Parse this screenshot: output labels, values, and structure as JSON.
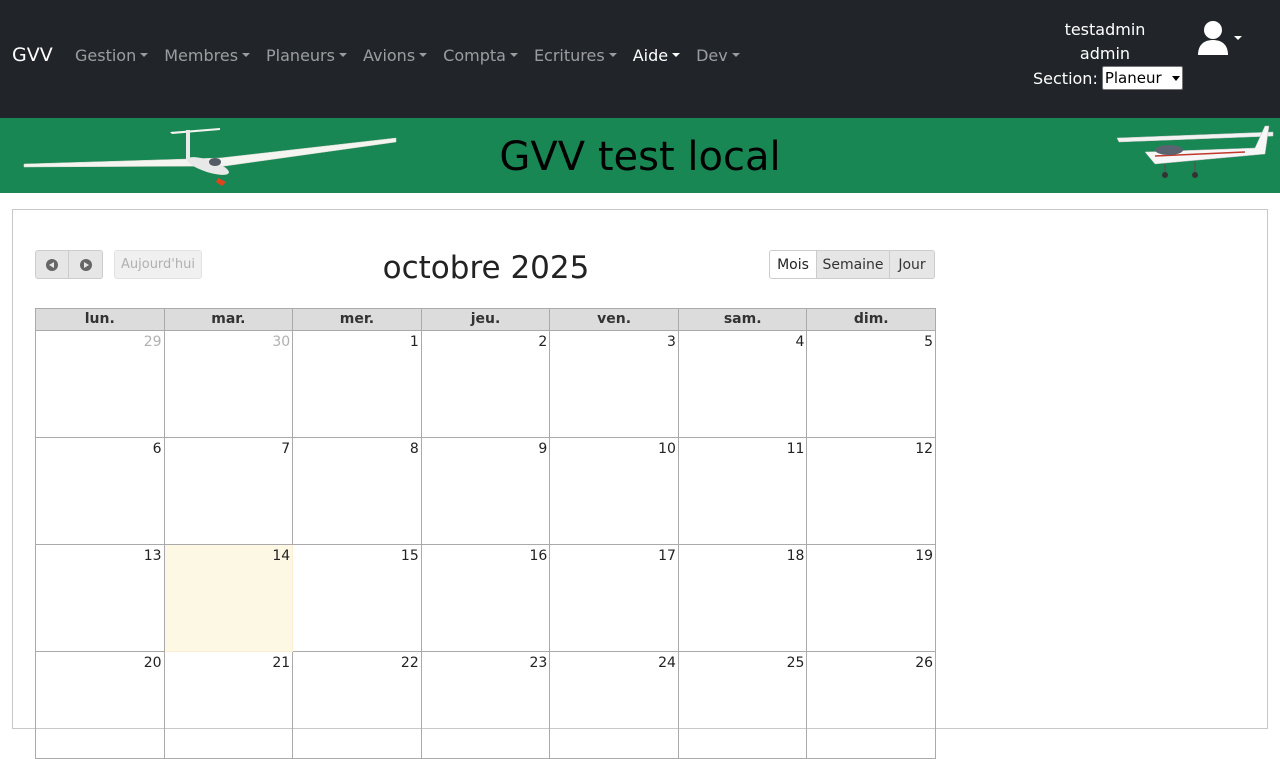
{
  "navbar": {
    "brand": "GVV",
    "menu": [
      {
        "label": "Gestion"
      },
      {
        "label": "Membres"
      },
      {
        "label": "Planeurs"
      },
      {
        "label": "Avions"
      },
      {
        "label": "Compta"
      },
      {
        "label": "Ecritures"
      },
      {
        "label": "Aide"
      },
      {
        "label": "Dev"
      }
    ],
    "user": {
      "name": "testadmin",
      "role": "admin",
      "section_label": "Section:",
      "section_value": "Planeur"
    }
  },
  "banner": {
    "title": "GVV test local",
    "color": "#198754"
  },
  "calendar": {
    "title": "octobre 2025",
    "today_label": "Aujourd'hui",
    "views": [
      "Mois",
      "Semaine",
      "Jour"
    ],
    "active_view": "Mois",
    "weekdays": [
      "lun.",
      "mar.",
      "mer.",
      "jeu.",
      "ven.",
      "sam.",
      "dim."
    ],
    "weeks": [
      [
        "29",
        "30",
        "1",
        "2",
        "3",
        "4",
        "5"
      ],
      [
        "6",
        "7",
        "8",
        "9",
        "10",
        "11",
        "12"
      ],
      [
        "13",
        "14",
        "15",
        "16",
        "17",
        "18",
        "19"
      ],
      [
        "20",
        "21",
        "22",
        "23",
        "24",
        "25",
        "26"
      ]
    ],
    "today": "14",
    "today_color": "#fcf8e3"
  }
}
